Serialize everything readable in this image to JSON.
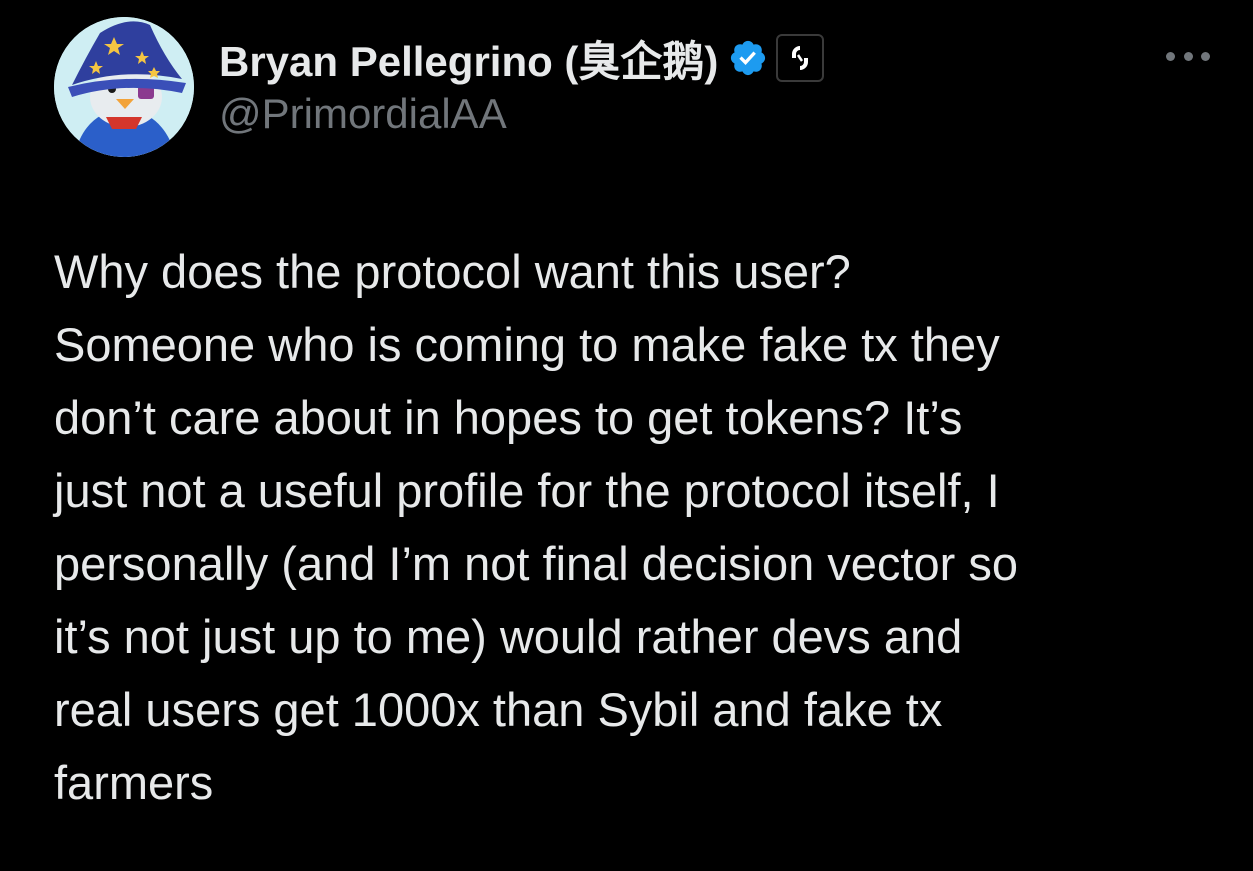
{
  "tweet": {
    "author": {
      "display_name": "Bryan Pellegrino (臭企鹅)",
      "handle": "@PrimordialAA",
      "verified_badge_color": "#1d9bf0",
      "affiliate_icon": "layerzero-logo-icon",
      "avatar_icon": "penguin-wizard-avatar-icon"
    },
    "more_menu_icon": "more-options-icon",
    "text_lines": [
      "Why does the protocol want this user?",
      "Someone who is coming to make fake tx they",
      "don’t care about in hopes to get tokens? It’s",
      "just not a useful profile for the protocol itself, I",
      "personally (and I’m not final decision vector so",
      "it’s not just up to me) would rather devs and",
      "real users get 1000x than Sybil and fake tx",
      "farmers"
    ]
  },
  "colors": {
    "background": "#000000",
    "primary_text": "#e7e9ea",
    "secondary_text": "#71767b",
    "accent": "#1d9bf0"
  }
}
